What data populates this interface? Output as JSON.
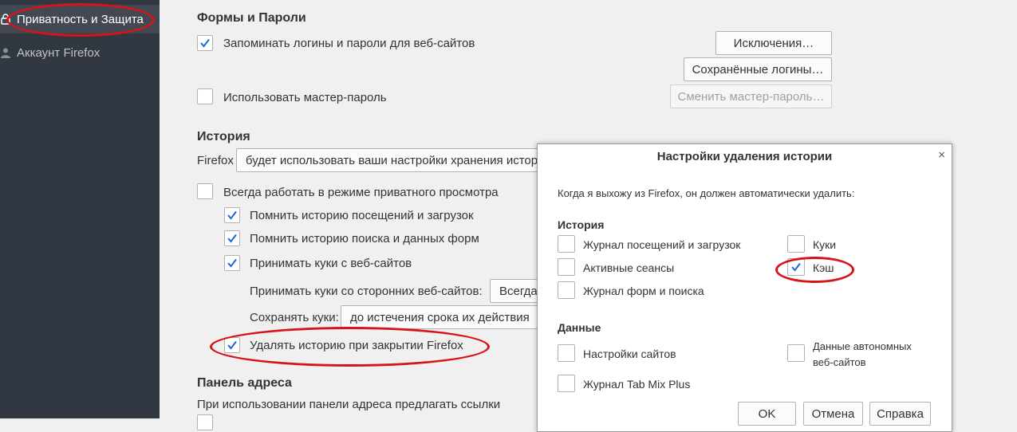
{
  "sidebar": {
    "items": [
      {
        "label": "Приватность и Защита",
        "icon": "lock-icon"
      },
      {
        "label": "Аккаунт Firefox",
        "icon": "account-icon"
      }
    ]
  },
  "forms": {
    "heading": "Формы и Пароли",
    "remember_logins": {
      "label": "Запоминать логины и пароли для веб-сайтов",
      "checked": true
    },
    "exceptions_button": "Исключения…",
    "saved_logins_button": "Сохранённые логины…",
    "master_password": {
      "label": "Использовать мастер-пароль",
      "checked": false
    },
    "change_master_button": "Сменить мастер-пароль…"
  },
  "history": {
    "heading": "История",
    "firefox_label": "Firefox",
    "mode_select_value": "будет использовать ваши настройки хранения истор",
    "always_private": {
      "label": "Всегда работать в режиме приватного просмотра",
      "checked": false
    },
    "remember_browsing": {
      "label": "Помнить историю посещений и загрузок",
      "checked": true
    },
    "remember_search": {
      "label": "Помнить историю поиска и данных форм",
      "checked": true
    },
    "accept_cookies": {
      "label": "Принимать куки с веб-сайтов",
      "checked": true
    },
    "third_party_label": "Принимать куки со сторонних веб-сайтов:",
    "third_party_value": "Всегда",
    "keep_cookies_label": "Сохранять куки:",
    "keep_cookies_value": "до истечения срока их действия",
    "clear_on_close": {
      "label": "Удалять историю при закрытии Firefox",
      "checked": true
    }
  },
  "address_bar": {
    "heading": "Панель адреса",
    "desc": "При использовании панели адреса предлагать ссылки"
  },
  "dialog": {
    "title": "Настройки удаления истории",
    "close_glyph": "×",
    "intro": "Когда я выхожу из Firefox, он должен автоматически удалить:",
    "history_heading": "История",
    "browsing_history": {
      "label": "Журнал посещений и загрузок",
      "checked": false
    },
    "active_sessions": {
      "label": "Активные сеансы",
      "checked": false
    },
    "form_history": {
      "label": "Журнал форм и поиска",
      "checked": false
    },
    "cookies": {
      "label": "Куки",
      "checked": false
    },
    "cache": {
      "label": "Кэш",
      "checked": true
    },
    "data_heading": "Данные",
    "site_settings": {
      "label": "Настройки сайтов",
      "checked": false
    },
    "tabmix_log": {
      "label": "Журнал Tab Mix Plus",
      "checked": false
    },
    "offline_data": {
      "label_line1": "Данные автономных",
      "label_line2": "веб-сайтов",
      "checked": false
    },
    "ok_button": "OK",
    "cancel_button": "Отмена",
    "help_button": "Справка"
  },
  "colors": {
    "sidebar_bg": "#323841",
    "sidebar_selected": "#424953",
    "checkmark": "#1a6cd6",
    "annotation": "#d8141b"
  }
}
